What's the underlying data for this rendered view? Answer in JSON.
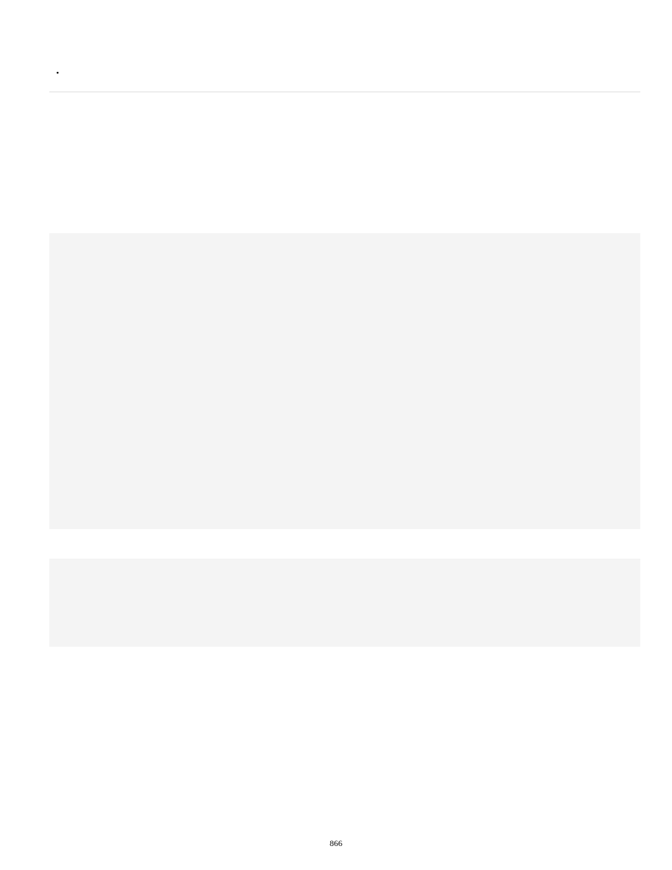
{
  "bullets": {
    "b1": "",
    "b2": "",
    "b3": "",
    "b4": "",
    "b5": "",
    "b6": ""
  },
  "page_number": "866"
}
